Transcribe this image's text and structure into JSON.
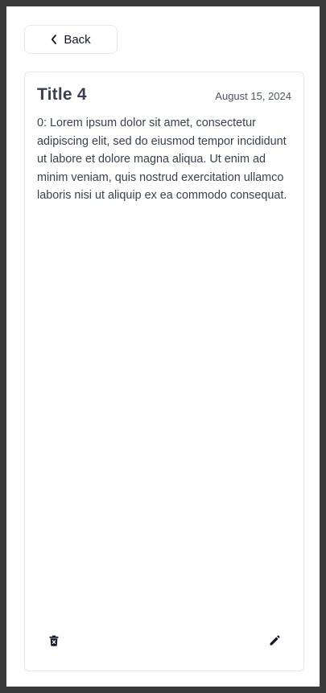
{
  "nav": {
    "back_label": "Back",
    "back_icon": "chevron-left-icon"
  },
  "note": {
    "title": "Title 4",
    "date": "August 15, 2024",
    "body": "0: Lorem ipsum dolor sit amet, consectetur adipiscing elit, sed do eiusmod tempor incididunt ut labore et dolore magna aliqua. Ut enim ad minim veniam, quis nostrud exercitation ullamco laboris nisi ut aliquip ex ea commodo consequat."
  },
  "actions": {
    "delete_icon": "trash-icon",
    "edit_icon": "pencil-icon"
  },
  "colors": {
    "page_background": "#ffffff",
    "frame": "#3a3a3a",
    "border": "#e5e7eb",
    "title_text": "#374151",
    "icon": "#111827"
  }
}
